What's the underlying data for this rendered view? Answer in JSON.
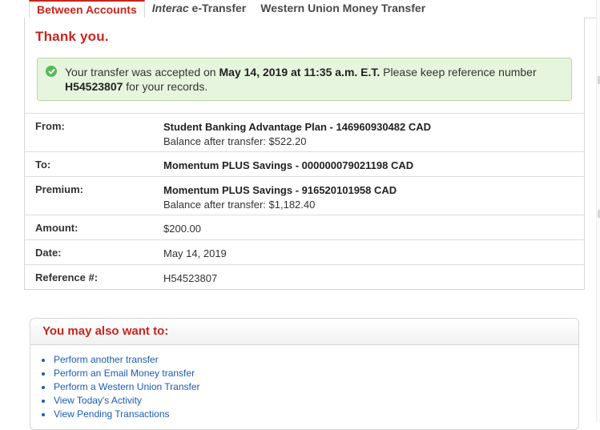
{
  "tabs": [
    {
      "label": "Between Accounts",
      "active": true
    },
    {
      "label_em": "Interac",
      "label_rest": " e-Transfer",
      "active": false
    },
    {
      "label": "Western Union Money Transfer",
      "active": false
    }
  ],
  "page_title": "Thank you.",
  "alert": {
    "part1": "Your transfer was accepted on ",
    "datetime": "May 14, 2019 at 11:35 a.m. E.T.",
    "part2": " Please keep reference number ",
    "reference": "H54523807",
    "part3": " for your records."
  },
  "details": {
    "from_label": "From:",
    "from_account": "Student Banking Advantage Plan - 146960930482 CAD",
    "from_balance": "Balance after transfer: $522.20",
    "to_label": "To:",
    "to_account": "Momentum PLUS Savings - 000000079021198 CAD",
    "premium_label": "Premium:",
    "premium_account": "Momentum PLUS Savings - 916520101958 CAD",
    "premium_balance": "Balance after transfer: $1,182.40",
    "amount_label": "Amount:",
    "amount": "$200.00",
    "date_label": "Date:",
    "date": "May 14, 2019",
    "reference_label": "Reference #:",
    "reference": "H54523807"
  },
  "more": {
    "title": "You may also want to:",
    "links": [
      "Perform another transfer",
      "Perform an Email Money transfer",
      "Perform a Western Union Transfer",
      "View Today's Activity",
      "View Pending Transactions"
    ]
  },
  "colors": {
    "accent": "#c9251d",
    "success_bg": "#e6f5dd",
    "link": "#1a5cb5"
  }
}
